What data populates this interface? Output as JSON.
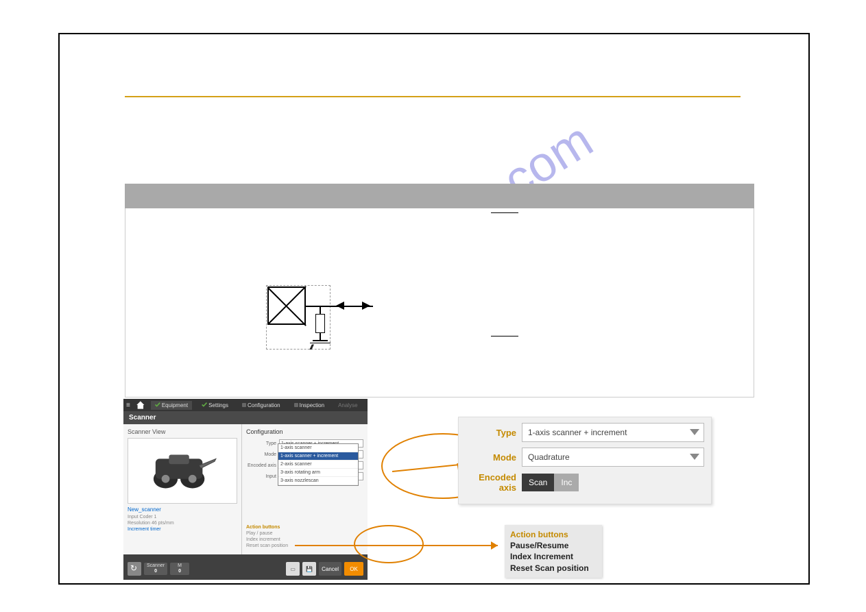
{
  "watermark": "manualshive.com",
  "schematic_hatch": "////",
  "scanner_ui": {
    "top_tabs": [
      "Equipment",
      "Settings",
      "Configuration",
      "Inspection",
      "Analyse"
    ],
    "header": "Scanner",
    "view_title": "Scanner View",
    "link": "New_scanner",
    "meta_lines": [
      "Input          Coder 1",
      "Resolution   46 pts/mm",
      "Increment timer"
    ],
    "config_title": "Configuration",
    "fields": {
      "type": "Type",
      "mode": "Mode",
      "encoded_axis": "Encoded axis",
      "input": "Input"
    },
    "type_value": "1-axis scanner + increment",
    "dropdown_options": [
      "1-axis scanner",
      "1-axis scanner + increment",
      "2-axis scanner",
      "3-axis rotating arm",
      "3-axis nozzlescan"
    ],
    "action_title": "Action buttons",
    "action_lines": [
      "Play / pause",
      "Index increment",
      "Reset scan position"
    ],
    "bottom": {
      "scanner_stat_label": "Scanner",
      "scanner_stat_value": "0",
      "m_stat_label": "M",
      "m_stat_value": "0",
      "cancel": "Cancel",
      "ok": "OK"
    }
  },
  "cfg_panel": {
    "type_label": "Type",
    "type_value": "1-axis scanner + increment",
    "mode_label": "Mode",
    "mode_value": "Quadrature",
    "encoded_label": "Encoded axis",
    "tog_scan": "Scan",
    "tog_inc": "Inc"
  },
  "action_box": {
    "title": "Action buttons",
    "lines": [
      "Pause/Resume",
      "Index Increment",
      "Reset Scan position"
    ]
  }
}
